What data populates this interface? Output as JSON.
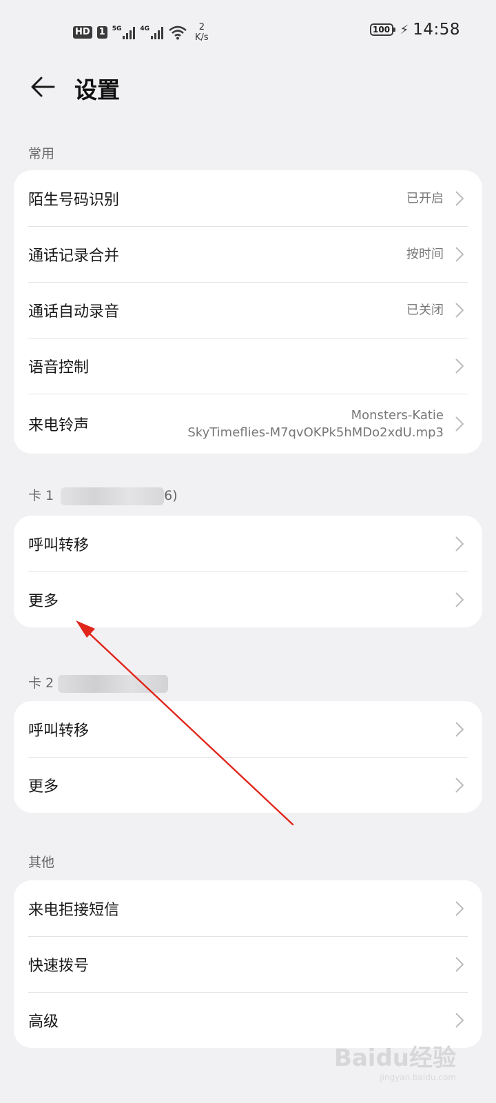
{
  "status_bar": {
    "hd_badge": "HD",
    "sim_badge": "1",
    "net1": "5G",
    "net2": "4G",
    "speed_value": "2",
    "speed_unit": "K/s",
    "battery": "100",
    "time": "14:58"
  },
  "header": {
    "title": "设置"
  },
  "sections": {
    "common": {
      "label": "常用",
      "items": [
        {
          "label": "陌生号码识别",
          "value": "已开启"
        },
        {
          "label": "通话记录合并",
          "value": "按时间"
        },
        {
          "label": "通话自动录音",
          "value": "已关闭"
        },
        {
          "label": "语音控制",
          "value": ""
        },
        {
          "label": "来电铃声",
          "value_line1": "Monsters-Katie",
          "value_line2": "SkyTimeflies-M7qvOKPk5hMDo2xdU.mp3"
        }
      ]
    },
    "card1": {
      "label_prefix": "卡 1",
      "label_suffix": "6)",
      "items": [
        {
          "label": "呼叫转移"
        },
        {
          "label": "更多"
        }
      ]
    },
    "card2": {
      "label_prefix": "卡 2",
      "items": [
        {
          "label": "呼叫转移"
        },
        {
          "label": "更多"
        }
      ]
    },
    "other": {
      "label": "其他",
      "items": [
        {
          "label": "来电拒接短信"
        },
        {
          "label": "快速拨号"
        },
        {
          "label": "高级"
        }
      ]
    }
  },
  "annotation": {
    "arrow_color": "#e0251b"
  },
  "watermark": {
    "text": "Baidu经验",
    "sub": "jingyan.baidu.com"
  },
  "icons": [
    "back-arrow-icon",
    "chevron-right-icon",
    "wifi-icon",
    "signal-icon",
    "battery-icon",
    "charging-icon"
  ]
}
